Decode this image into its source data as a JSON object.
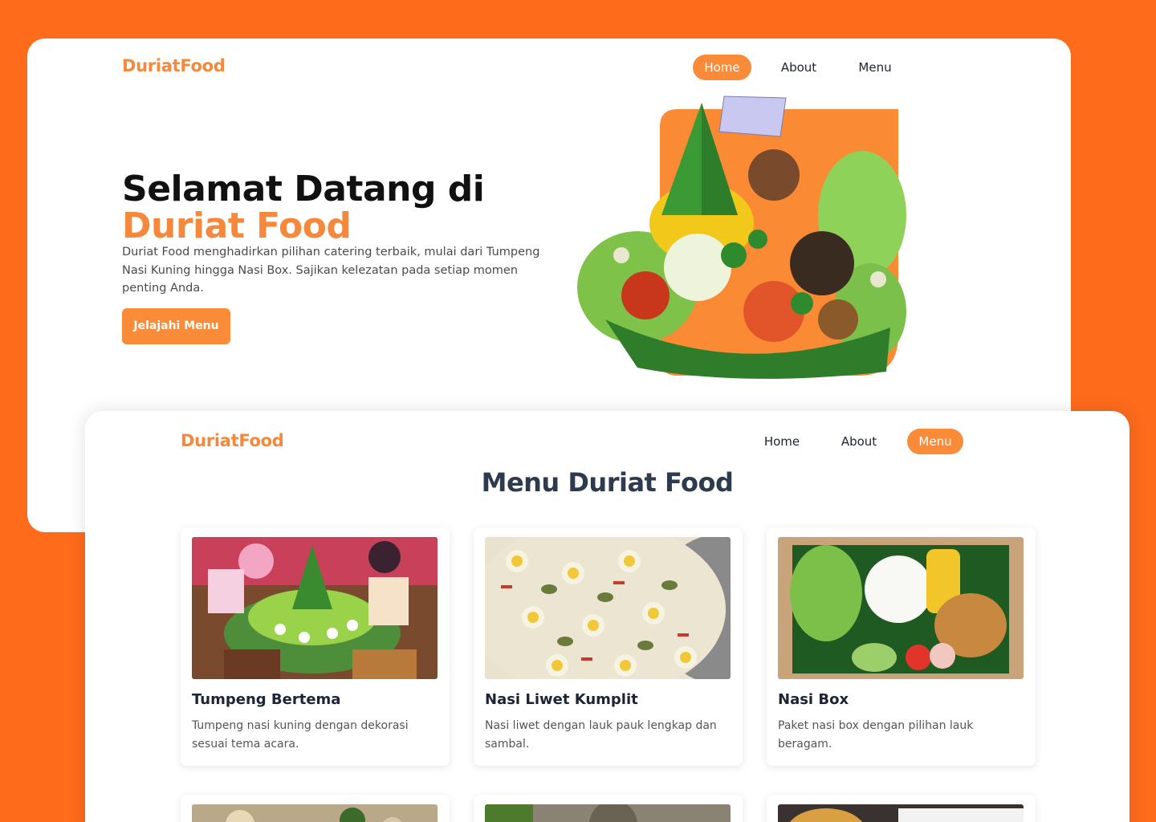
{
  "hero_page": {
    "brand": "DuriatFood",
    "nav": [
      {
        "label": "Home",
        "active": true
      },
      {
        "label": "About",
        "active": false
      },
      {
        "label": "Menu",
        "active": false
      }
    ],
    "title_line1": "Selamat Datang di",
    "title_line2": "Duriat Food",
    "description": "Duriat Food menghadirkan pilihan catering terbaik, mulai dari Tumpeng Nasi Kuning hingga Nasi Box. Sajikan kelezatan pada setiap momen penting Anda.",
    "cta_label": "Jelajahi Menu",
    "image": "tumpeng-nasi-kuning-photo"
  },
  "menu_page": {
    "brand": "DuriatFood",
    "nav": [
      {
        "label": "Home",
        "active": false
      },
      {
        "label": "About",
        "active": false
      },
      {
        "label": "Menu",
        "active": true
      }
    ],
    "title": "Menu Duriat Food",
    "items": [
      {
        "name": "Tumpeng Bertema",
        "description": "Tumpeng nasi kuning dengan dekorasi sesuai tema acara.",
        "image": "tumpeng-bertema-photo"
      },
      {
        "name": "Nasi Liwet Kumplit",
        "description": "Nasi liwet dengan lauk pauk lengkap dan sambal.",
        "image": "nasi-liwet-photo"
      },
      {
        "name": "Nasi Box",
        "description": "Paket nasi box dengan pilihan lauk beragam.",
        "image": "nasi-box-photo"
      }
    ]
  },
  "colors": {
    "background": "#fe6b1b",
    "accent": "#f98b39",
    "brand": "#f5883a",
    "heading_dark": "#2e3a4d"
  }
}
